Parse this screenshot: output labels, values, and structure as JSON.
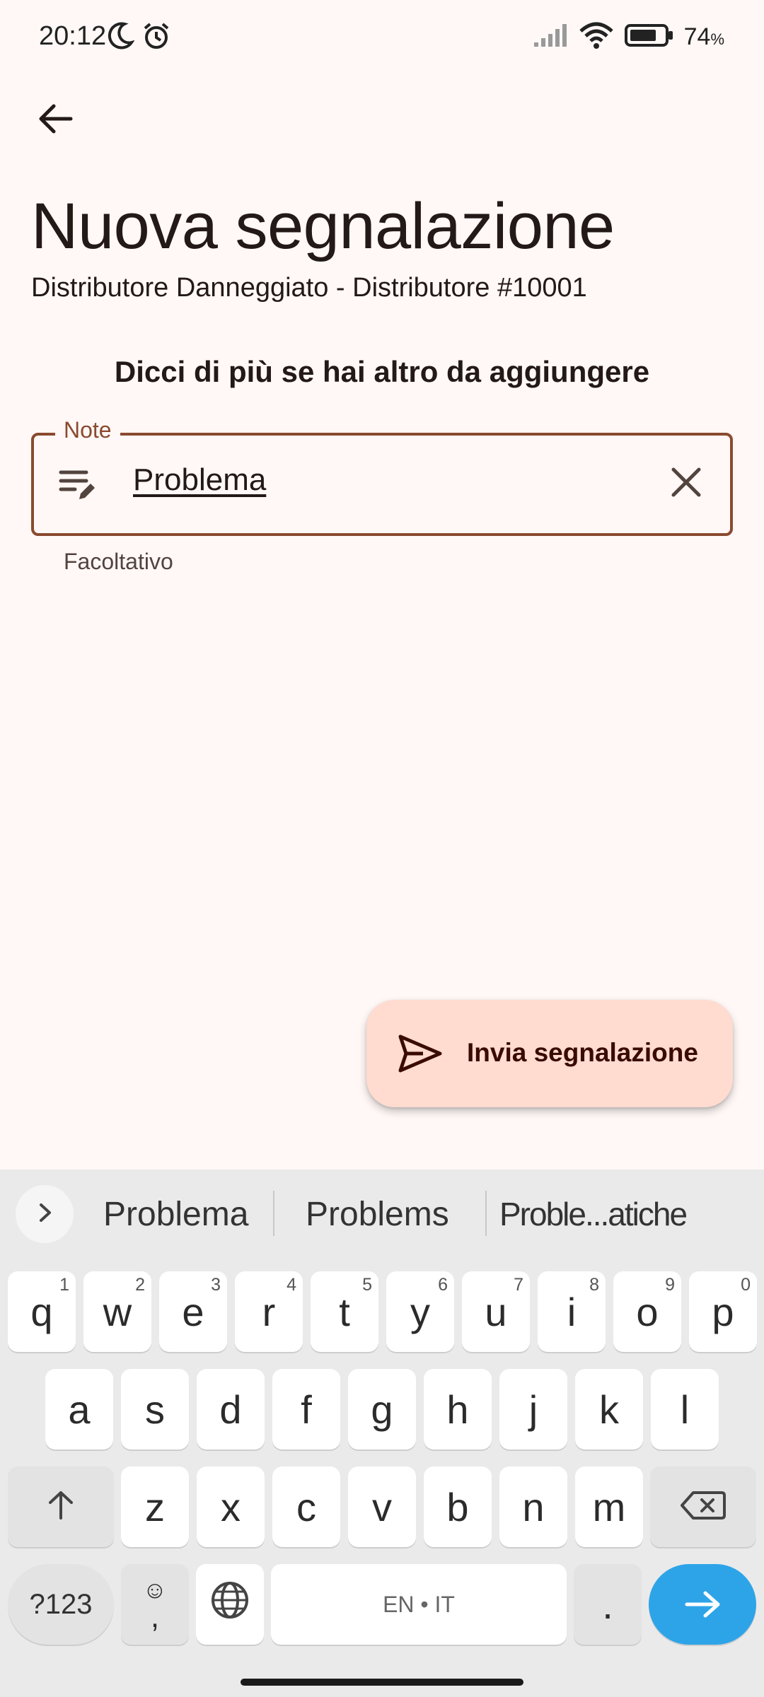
{
  "status_bar": {
    "time": "20:12",
    "battery_percent": "74",
    "battery_unit": "%",
    "icons": [
      "moon-icon",
      "alarm-icon",
      "signal-icon",
      "wifi-icon",
      "battery-icon"
    ]
  },
  "header": {
    "title": "Nuova segnalazione",
    "subtitle": "Distributore Danneggiato - Distributore #10001"
  },
  "form": {
    "prompt": "Dicci di più se hai altro da aggiungere",
    "note": {
      "label": "Note",
      "value": "Problema",
      "supporting_text": "Facoltativo"
    }
  },
  "fab": {
    "label": "Invia segnalazione",
    "icon": "send-icon"
  },
  "keyboard": {
    "suggestions": [
      "Problema",
      "Problems",
      "Proble...atiche"
    ],
    "row1": [
      {
        "k": "q",
        "h": "1"
      },
      {
        "k": "w",
        "h": "2"
      },
      {
        "k": "e",
        "h": "3"
      },
      {
        "k": "r",
        "h": "4"
      },
      {
        "k": "t",
        "h": "5"
      },
      {
        "k": "y",
        "h": "6"
      },
      {
        "k": "u",
        "h": "7"
      },
      {
        "k": "i",
        "h": "8"
      },
      {
        "k": "o",
        "h": "9"
      },
      {
        "k": "p",
        "h": "0"
      }
    ],
    "row2": [
      "a",
      "s",
      "d",
      "f",
      "g",
      "h",
      "j",
      "k",
      "l"
    ],
    "row3": [
      "z",
      "x",
      "c",
      "v",
      "b",
      "n",
      "m"
    ],
    "symbols_label": "?123",
    "emoji_top": "☺",
    "comma": ",",
    "space_label": "EN • IT",
    "period": ".",
    "colors": {
      "accent": "#8a4a2f",
      "fab_bg": "#ffdbd0",
      "enter_key": "#2ea4e8"
    }
  }
}
